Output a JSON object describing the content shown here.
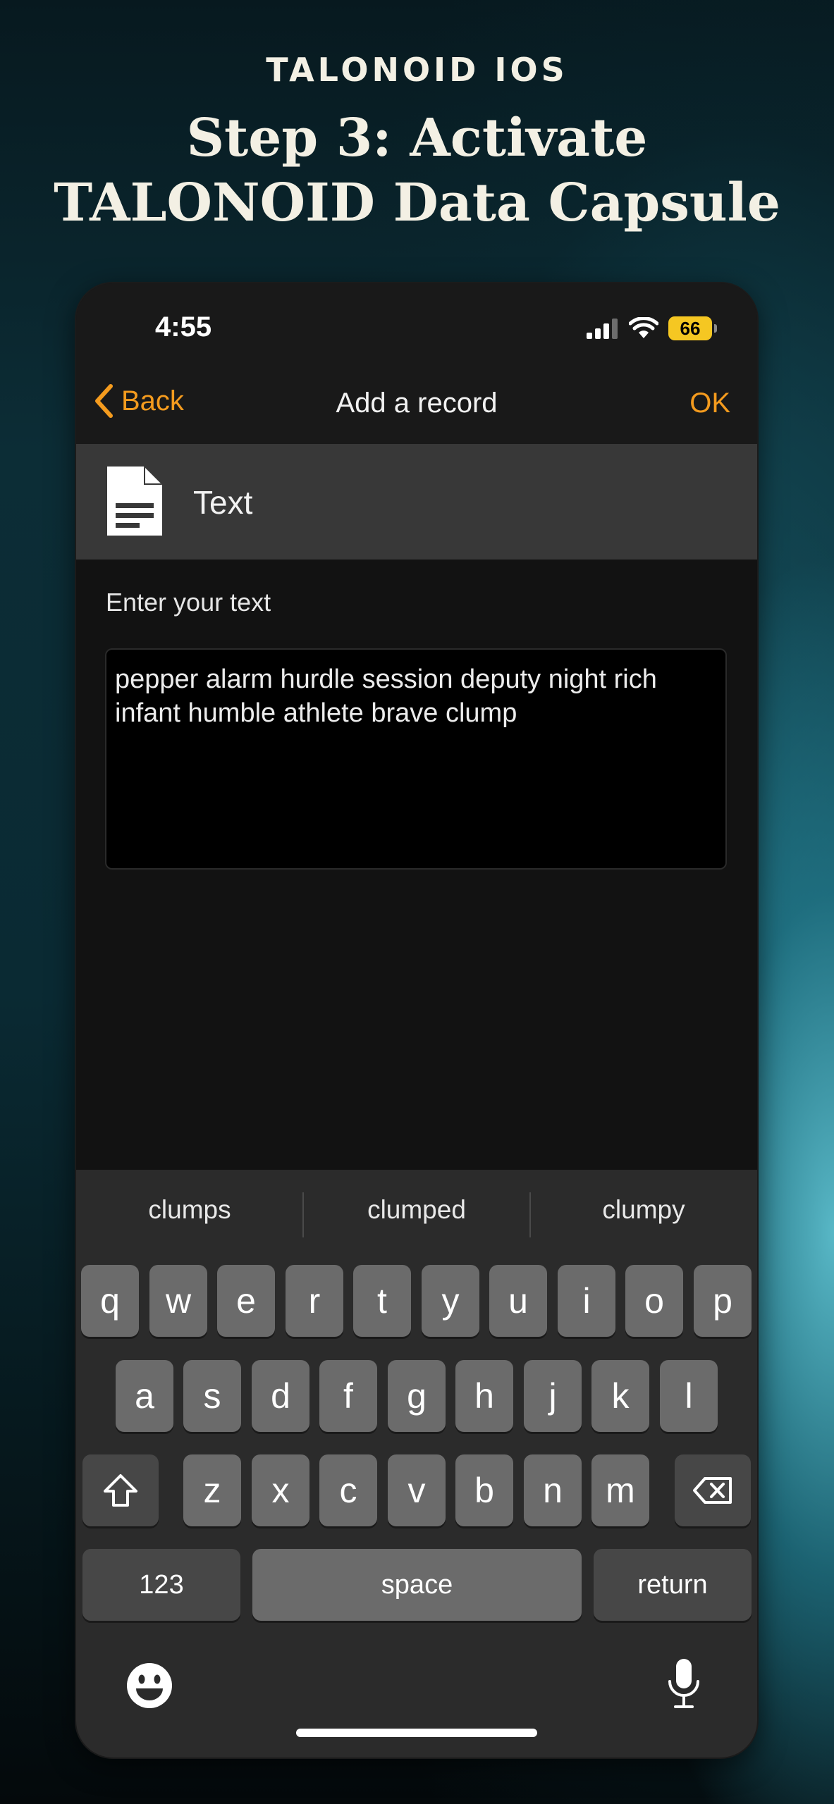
{
  "header": {
    "kicker": "TALONOID IOS",
    "title_line1": "Step 3: Activate",
    "title_line2": "TALONOID Data Capsule"
  },
  "status_bar": {
    "time": "4:55",
    "battery": "66",
    "icons": [
      "cellular-signal-icon",
      "wifi-icon",
      "battery-icon"
    ]
  },
  "nav": {
    "back_label": "Back",
    "title": "Add a record",
    "ok_label": "OK"
  },
  "record_type": {
    "icon": "document-icon",
    "label": "Text"
  },
  "form": {
    "prompt": "Enter your text",
    "text_value": "pepper alarm hurdle session deputy night rich infant humble athlete brave clump"
  },
  "keyboard": {
    "suggestions": [
      "clumps",
      "clumped",
      "clumpy"
    ],
    "row1": [
      "q",
      "w",
      "e",
      "r",
      "t",
      "y",
      "u",
      "i",
      "o",
      "p"
    ],
    "row2": [
      "a",
      "s",
      "d",
      "f",
      "g",
      "h",
      "j",
      "k",
      "l"
    ],
    "row3": [
      "z",
      "x",
      "c",
      "v",
      "b",
      "n",
      "m"
    ],
    "numbers_label": "123",
    "space_label": "space",
    "return_label": "return"
  },
  "colors": {
    "accent": "#f49b1e",
    "battery": "#f5c722",
    "title_text": "#f3f0e4"
  }
}
